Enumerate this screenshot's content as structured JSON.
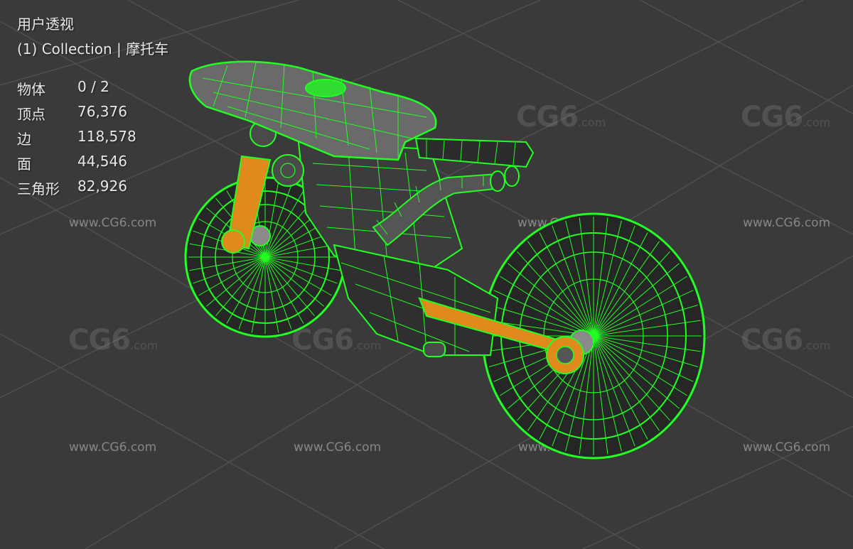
{
  "viewport": {
    "view_name": "用户透视",
    "collection": "(1) Collection | 摩托车",
    "stats": [
      {
        "label": "物体",
        "value": "0 / 2"
      },
      {
        "label": "顶点",
        "value": "76,376"
      },
      {
        "label": "边",
        "value": "118,578"
      },
      {
        "label": "面",
        "value": "44,546"
      },
      {
        "label": "三角形",
        "value": "82,926"
      }
    ]
  },
  "watermark": {
    "logo_text": "CG6",
    "logo_suffix": ".com",
    "url_text": "www.CG6.com"
  },
  "colors": {
    "background": "#3a3a3a",
    "grid_line": "#4f4f4f",
    "wireframe": "#22ff22",
    "wire_shadow": "#0d3b0d",
    "body_shade": "#5a5a5a",
    "accent_orange": "#e08a1e"
  },
  "model": {
    "name": "motorcycle-wireframe",
    "icon": "motorcycle-icon"
  }
}
